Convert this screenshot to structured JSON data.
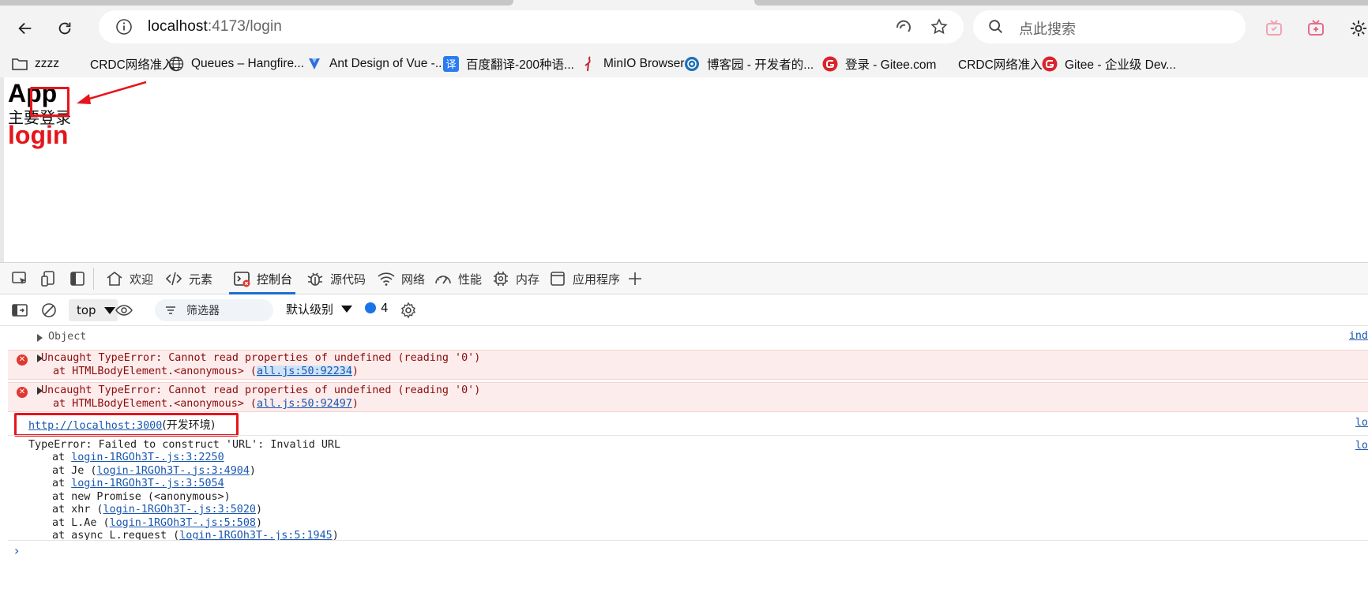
{
  "browser": {
    "url_host": "localhost",
    "url_rest": ":4173/login",
    "search_placeholder": "点此搜索"
  },
  "bookmarks": [
    {
      "label": "zzzz",
      "icon": "folder-icon"
    },
    {
      "label": "CRDC网络准入",
      "icon": "blank-page-icon"
    },
    {
      "label": "Queues – Hangfire...",
      "icon": "globe-icon"
    },
    {
      "label": "Ant Design of Vue -...",
      "icon": "vue-logo-icon"
    },
    {
      "label": "百度翻译-200种语...",
      "icon": "translate-icon"
    },
    {
      "label": "MinIO Browser",
      "icon": "minio-icon"
    },
    {
      "label": "博客园 - 开发者的...",
      "icon": "cnblogs-icon"
    },
    {
      "label": "登录 - Gitee.com",
      "icon": "gitee-icon"
    },
    {
      "label": "CRDC网络准入",
      "icon": "blank-page-icon"
    },
    {
      "label": "Gitee - 企业级 Dev...",
      "icon": "gitee-icon"
    }
  ],
  "page": {
    "title": "App",
    "subtitle": "主要登录",
    "login": "login"
  },
  "devtools": {
    "tabs": [
      {
        "label": "欢迎",
        "icon": "home-icon"
      },
      {
        "label": "元素",
        "icon": "code-icon"
      },
      {
        "label": "控制台",
        "icon": "console-icon",
        "active": true
      },
      {
        "label": "源代码",
        "icon": "bug-icon"
      },
      {
        "label": "网络",
        "icon": "wifi-icon"
      },
      {
        "label": "性能",
        "icon": "gauge-icon"
      },
      {
        "label": "内存",
        "icon": "chip-icon"
      },
      {
        "label": "应用程序",
        "icon": "app-icon"
      }
    ],
    "context": "top",
    "filter_placeholder": "筛选器",
    "level": "默认级别",
    "issue_count": "4"
  },
  "console": {
    "object_label": "Object",
    "object_src": "ind",
    "errors": [
      {
        "message": "Uncaught TypeError: Cannot read properties of undefined (reading '0')",
        "at_prefix": "at HTMLBodyElement.<anonymous> (",
        "link": "all.js:50:92234",
        "at_suffix": ")"
      },
      {
        "message": "Uncaught TypeError: Cannot read properties of undefined (reading '0')",
        "at_prefix": "at HTMLBodyElement.<anonymous> (",
        "link": "all.js:50:92497",
        "at_suffix": ")"
      }
    ],
    "log_link": "http://localhost:3000",
    "log_text": "(开发环境)",
    "log_src": "lo",
    "type_error": "TypeError: Failed to construct 'URL': Invalid URL",
    "type_error_src": "lo",
    "stack": [
      {
        "prefix": "at ",
        "link": "login-1RGOh3T-.js:3:2250",
        "suffix": ""
      },
      {
        "prefix": "at Je (",
        "link": "login-1RGOh3T-.js:3:4904",
        "suffix": ")"
      },
      {
        "prefix": "at ",
        "link": "login-1RGOh3T-.js:3:5054",
        "suffix": ""
      },
      {
        "prefix": "at new Promise (<anonymous>)",
        "link": "",
        "suffix": ""
      },
      {
        "prefix": "at xhr (",
        "link": "login-1RGOh3T-.js:3:5020",
        "suffix": ")"
      },
      {
        "prefix": "at L.Ae (",
        "link": "login-1RGOh3T-.js:5:508",
        "suffix": ")"
      },
      {
        "prefix": "at async L.request (",
        "link": "login-1RGOh3T-.js:5:1945",
        "suffix": ")"
      }
    ]
  },
  "colors": {
    "annotation_red": "#e8141b",
    "login_red": "#e5141b",
    "error_bg": "#fdecec",
    "link_blue": "#1a57b0"
  }
}
